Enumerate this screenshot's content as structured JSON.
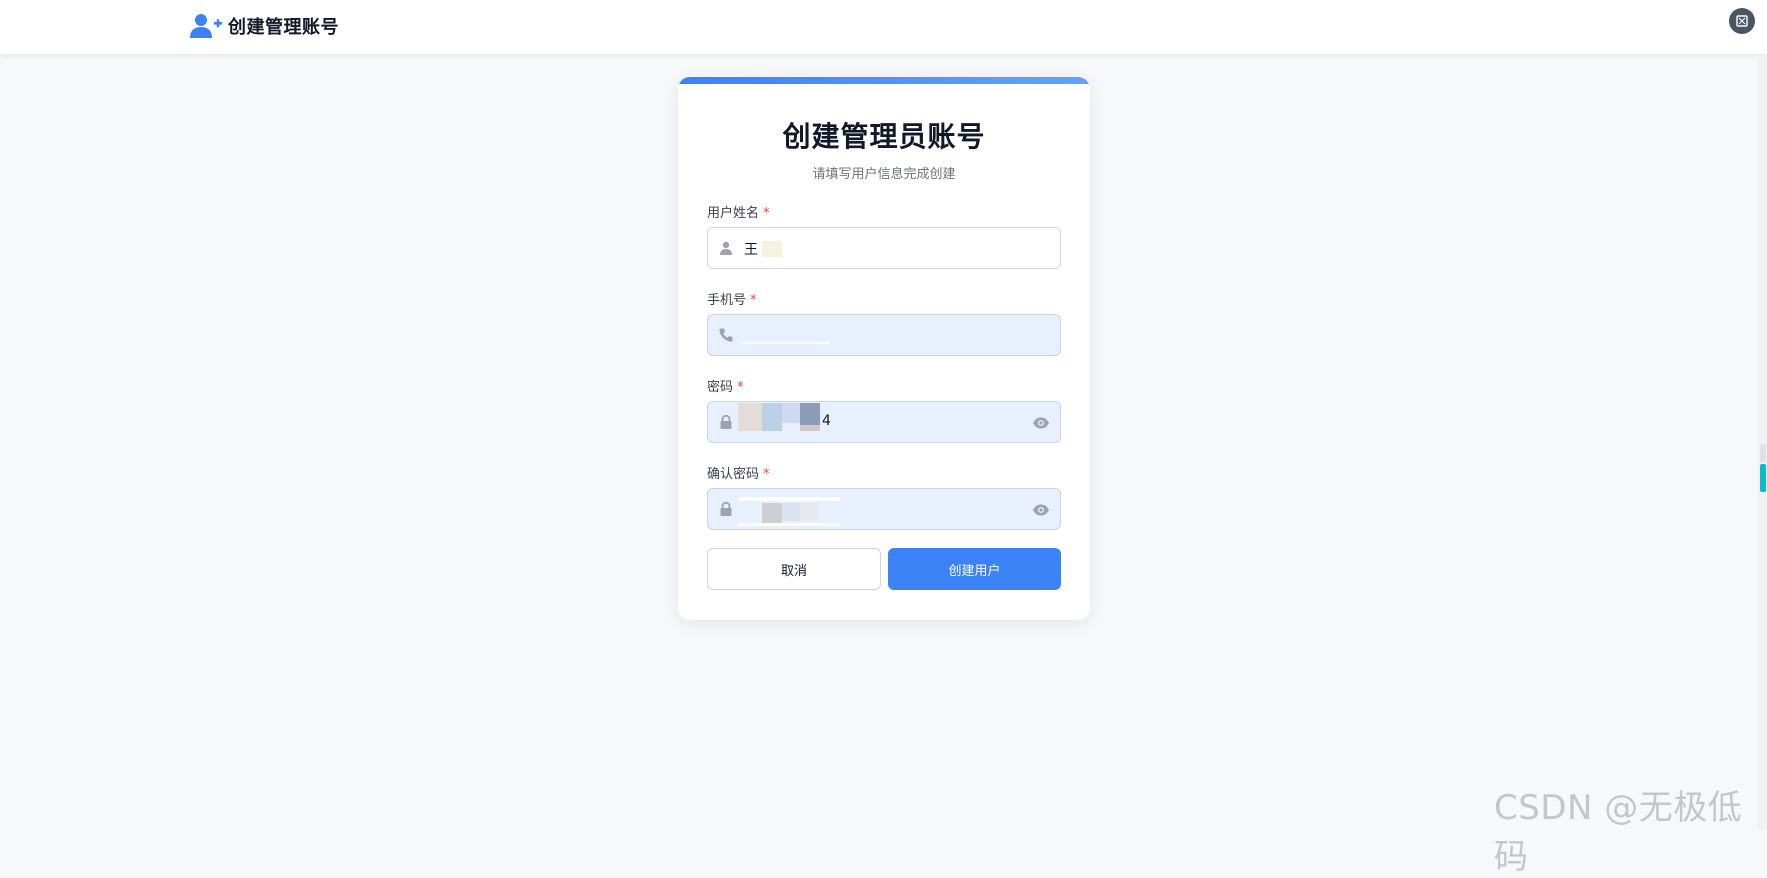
{
  "header": {
    "title": "创建管理账号",
    "icon": "add-user-icon",
    "accent_color": "#3b82f6"
  },
  "form": {
    "title": "创建管理员账号",
    "subtitle": "请填写用户信息完成创建",
    "required_mark": "*",
    "fields": [
      {
        "label": "用户姓名",
        "value": "王",
        "icon": "user-icon"
      },
      {
        "label": "手机号",
        "value": "",
        "icon": "phone-icon"
      },
      {
        "label": "密码",
        "value": "4",
        "icon": "lock-icon",
        "toggle": "eye-icon"
      },
      {
        "label": "确认密码",
        "value": "",
        "icon": "lock-icon",
        "toggle": "eye-icon"
      }
    ],
    "cancel_label": "取消",
    "submit_label": "创建用户"
  },
  "watermark": "CSDN @无极低码",
  "colors": {
    "primary": "#3b82f6",
    "required": "#ef4444",
    "filled_bg": "#e8effd"
  }
}
